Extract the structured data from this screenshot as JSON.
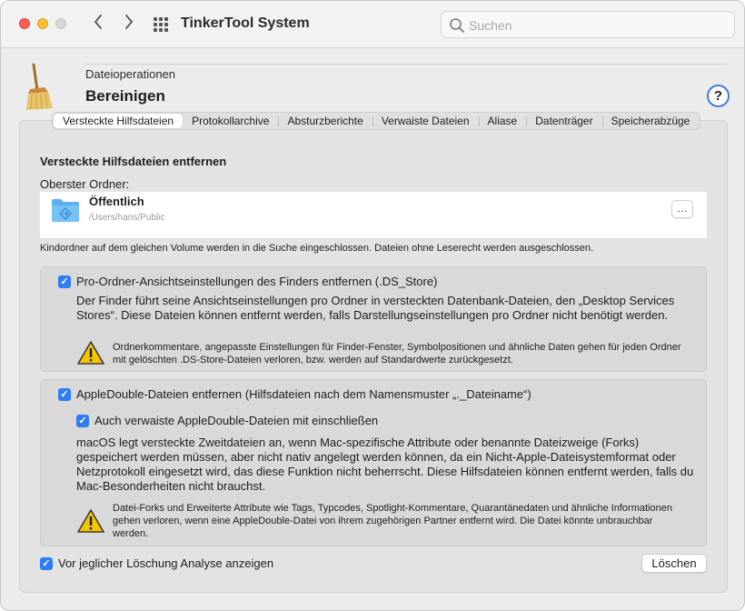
{
  "app": {
    "title": "TinkerTool System"
  },
  "search": {
    "placeholder": "Suchen"
  },
  "header": {
    "category": "Dateioperationen",
    "title": "Bereinigen",
    "help_label": "?"
  },
  "tabs": [
    {
      "label": "Versteckte Hilfsdateien",
      "active": true
    },
    {
      "label": "Protokollarchive",
      "active": false
    },
    {
      "label": "Absturzberichte",
      "active": false
    },
    {
      "label": "Verwaiste Dateien",
      "active": false
    },
    {
      "label": "Aliase",
      "active": false
    },
    {
      "label": "Datenträger",
      "active": false
    },
    {
      "label": "Speicherabzüge",
      "active": false
    }
  ],
  "section": {
    "title": "Versteckte Hilfsdateien entfernen",
    "folder_label": "Oberster Ordner:",
    "folder_name": "Öffentlich",
    "folder_path": "/Users/hans/Public",
    "more_label": "…",
    "info": "Kindordner auf dem gleichen Volume werden in die Suche eingeschlossen. Dateien ohne Leserecht werden ausgeschlossen."
  },
  "ds_store": {
    "checked": true,
    "label": "Pro-Ordner-Ansichtseinstellungen des Finders entfernen (.DS_Store)",
    "description": "Der Finder führt seine Ansichtseinstellungen pro Ordner in versteckten Datenbank-Dateien, den „Desktop Services Stores“. Diese Dateien können entfernt werden, falls Darstellungseinstellungen pro Ordner nicht benötigt werden.",
    "warning": "Ordnerkommentare, angepasste Einstellungen für Finder-Fenster, Symbolpositionen und ähnliche Daten gehen für jeden Ordner mit gelöschten .DS-Store-Dateien verloren, bzw. werden auf Standardwerte zurückgesetzt."
  },
  "appledouble": {
    "checked": true,
    "label": "AppleDouble-Dateien entfernen (Hilfsdateien nach dem Namensmuster „._Dateiname“)",
    "orphan_checked": true,
    "orphan_label": "Auch verwaiste AppleDouble-Dateien mit einschließen",
    "description": "macOS legt versteckte Zweitdateien an, wenn Mac-spezifische Attribute oder benannte Dateizweige (Forks) gespeichert werden müssen, aber nicht nativ angelegt werden können, da ein Nicht-Apple-Dateisystemformat oder Netzprotokoll eingesetzt wird, das diese Funktion nicht beherrscht. Diese Hilfsdateien können entfernt werden, falls du Mac-Besonderheiten nicht brauchst.",
    "warning": "Datei-Forks und Erweiterte Attribute wie Tags, Typcodes, Spotlight-Kommentare, Quarantänedaten und ähnliche Informationen gehen verloren, wenn eine AppleDouble-Datei von ihrem zugehörigen Partner entfernt wird. Die Datei könnte unbrauchbar werden."
  },
  "footer": {
    "analyze_checked": true,
    "analyze_label": "Vor jeglicher Löschung Analyse anzeigen",
    "delete_label": "Löschen"
  },
  "colors": {
    "accent": "#2f7cf6",
    "help_ring": "#3e7de0",
    "close": "#fe5f57",
    "minimize": "#febc2e"
  }
}
